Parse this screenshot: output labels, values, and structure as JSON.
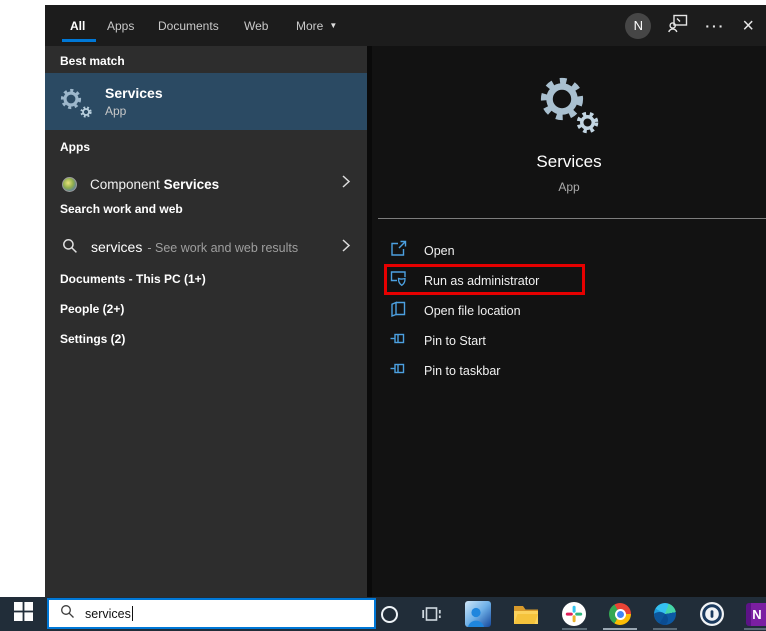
{
  "topbar": {
    "tabs": [
      {
        "label": "All",
        "active": true
      },
      {
        "label": "Apps",
        "active": false
      },
      {
        "label": "Documents",
        "active": false
      },
      {
        "label": "Web",
        "active": false
      },
      {
        "label": "More",
        "active": false,
        "has_caret": true
      }
    ],
    "caret_glyph": "▼",
    "avatar_letter": "N",
    "ellipsis_glyph": "···",
    "close_glyph": "×"
  },
  "left_panel": {
    "sections": {
      "best_match_header": "Best match",
      "apps_header": "Apps",
      "search_header": "Search work and web",
      "documents_header": "Documents - This PC (1+)",
      "people_header": "People (2+)",
      "settings_header": "Settings (2)"
    },
    "best_match": {
      "title": "Services",
      "subtitle": "App"
    },
    "component_services": {
      "normal": "Component",
      "bold": "Services"
    },
    "web_search": {
      "term": "services",
      "suffix": "- See work and web results"
    }
  },
  "right_panel": {
    "title": "Services",
    "subtitle": "App",
    "actions": [
      {
        "label": "Open",
        "icon": "open-icon"
      },
      {
        "label": "Run as administrator",
        "icon": "run-as-admin-icon",
        "annotated": true
      },
      {
        "label": "Open file location",
        "icon": "file-location-icon"
      },
      {
        "label": "Pin to Start",
        "icon": "pin-icon"
      },
      {
        "label": "Pin to taskbar",
        "icon": "pin-icon"
      }
    ]
  },
  "taskbar": {
    "search": {
      "value": "services"
    },
    "onenote_letter": "N",
    "icons": [
      "cortana",
      "task-view",
      "people",
      "file-explorer",
      "slack",
      "chrome",
      "edge",
      "1password",
      "onenote"
    ],
    "running_apps": [
      "slack",
      "chrome",
      "edge",
      "onenote"
    ],
    "active_app": "chrome"
  },
  "colors": {
    "accent": "#0078d7",
    "best_match_highlight": "#2b4a63",
    "annotation_red": "#e60000",
    "action_icon_blue": "#4ca0e0",
    "taskbar_bg": "#212d39"
  }
}
